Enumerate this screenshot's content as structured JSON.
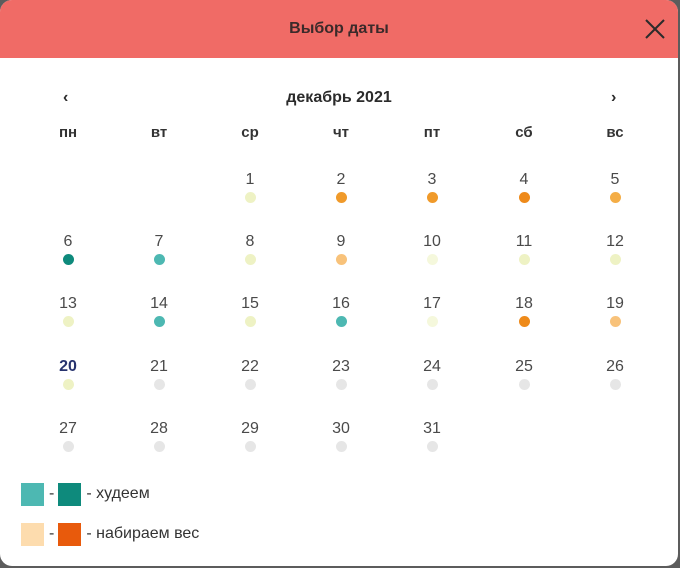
{
  "dialog": {
    "title": "Выбор даты"
  },
  "nav": {
    "prev": "‹",
    "next": "›",
    "month_label": "декабрь 2021"
  },
  "weekdays": [
    "пн",
    "вт",
    "ср",
    "чт",
    "пт",
    "сб",
    "вс"
  ],
  "colors": {
    "header": "#f06b66",
    "lose_light": "#4db8b2",
    "lose_dark": "#0e8a7c",
    "gain_light": "#fddcae",
    "gain_dark": "#e85a0c",
    "orange": "#f09a2a",
    "orange_light": "#f8c27a",
    "pale": "#eef2c4",
    "pale_light": "#f5f8dc",
    "grey": "#e6e6e6",
    "today": "#27336e"
  },
  "calendar": {
    "first_weekday_col": 2,
    "today": 20,
    "days": [
      {
        "n": "1",
        "c": "#eef2c4"
      },
      {
        "n": "2",
        "c": "#f09a2a"
      },
      {
        "n": "3",
        "c": "#f09a2a"
      },
      {
        "n": "4",
        "c": "#ee8a1a"
      },
      {
        "n": "5",
        "c": "#f4ad46"
      },
      {
        "n": "6",
        "c": "#0e8a7c"
      },
      {
        "n": "7",
        "c": "#4db8b2"
      },
      {
        "n": "8",
        "c": "#eef2c4"
      },
      {
        "n": "9",
        "c": "#f8c27a"
      },
      {
        "n": "10",
        "c": "#f5f8dc"
      },
      {
        "n": "11",
        "c": "#eef2c4"
      },
      {
        "n": "12",
        "c": "#eef2c4"
      },
      {
        "n": "13",
        "c": "#eef2c4"
      },
      {
        "n": "14",
        "c": "#4db8b2"
      },
      {
        "n": "15",
        "c": "#eef2c4"
      },
      {
        "n": "16",
        "c": "#4db8b2"
      },
      {
        "n": "17",
        "c": "#f5f8dc"
      },
      {
        "n": "18",
        "c": "#ee8a1a"
      },
      {
        "n": "19",
        "c": "#f8c27a"
      },
      {
        "n": "20",
        "c": "#eef2c4"
      },
      {
        "n": "21",
        "c": "#e6e6e6"
      },
      {
        "n": "22",
        "c": "#e6e6e6"
      },
      {
        "n": "23",
        "c": "#e6e6e6"
      },
      {
        "n": "24",
        "c": "#e6e6e6"
      },
      {
        "n": "25",
        "c": "#e6e6e6"
      },
      {
        "n": "26",
        "c": "#e6e6e6"
      },
      {
        "n": "27",
        "c": "#e6e6e6"
      },
      {
        "n": "28",
        "c": "#e6e6e6"
      },
      {
        "n": "29",
        "c": "#e6e6e6"
      },
      {
        "n": "30",
        "c": "#e6e6e6"
      },
      {
        "n": "31",
        "c": "#e6e6e6"
      }
    ]
  },
  "legend": {
    "dash": "-",
    "lose_label": "- худеем",
    "gain_label": "- набираем вес"
  }
}
